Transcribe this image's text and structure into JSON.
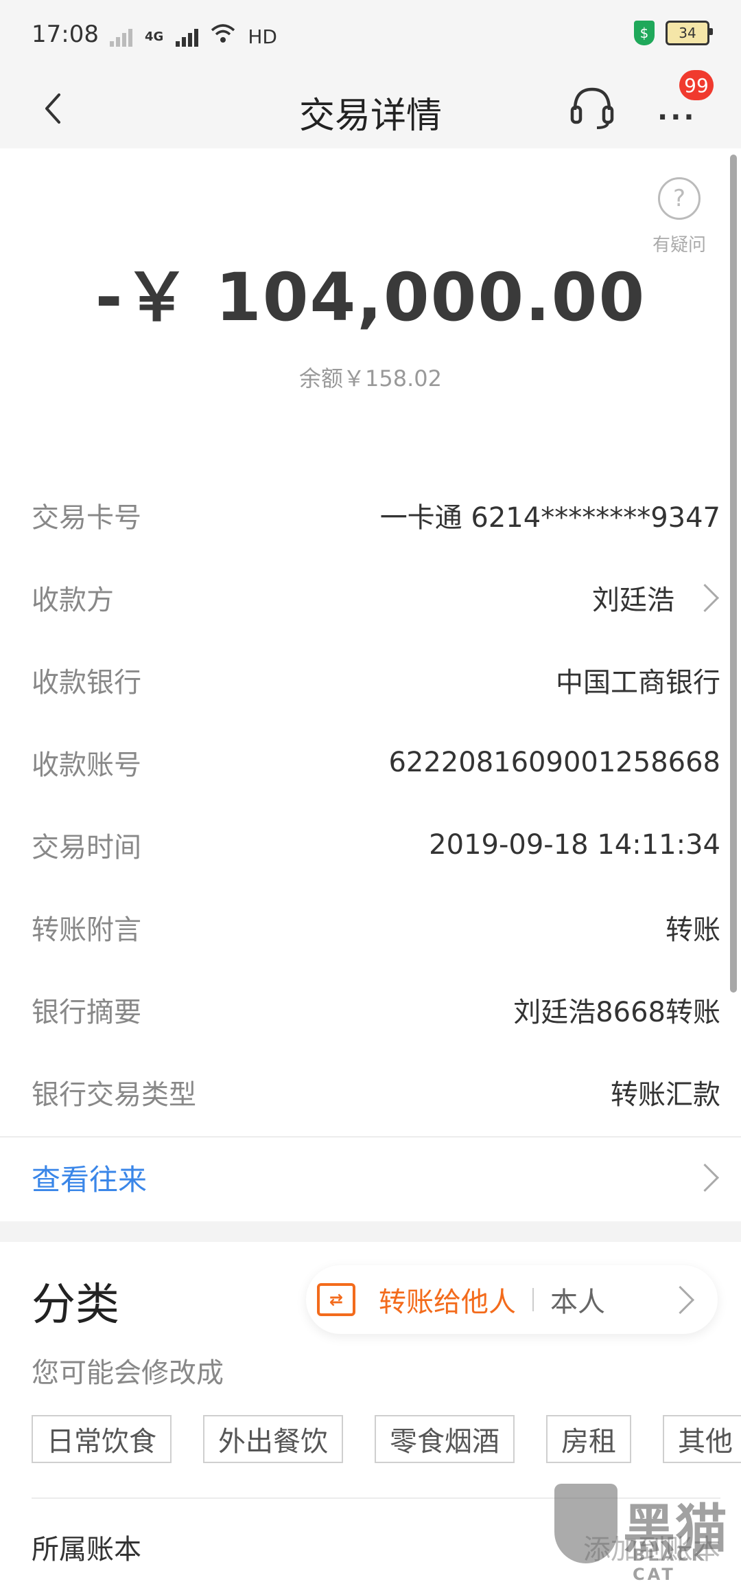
{
  "status": {
    "time": "17:08",
    "network": "4G",
    "hd": "HD",
    "battery": "34"
  },
  "nav": {
    "title": "交易详情",
    "badge": "99"
  },
  "help": {
    "label": "有疑问",
    "glyph": "?"
  },
  "amount": "-￥ 104,000.00",
  "balance": "余额￥158.02",
  "details": [
    {
      "label": "交易卡号",
      "value": "一卡通 6214********9347"
    },
    {
      "label": "收款方",
      "value": "刘廷浩"
    },
    {
      "label": "收款银行",
      "value": "中国工商银行"
    },
    {
      "label": "收款账号",
      "value": "6222081609001258668"
    },
    {
      "label": "交易时间",
      "value": "2019-09-18 14:11:34"
    },
    {
      "label": "转账附言",
      "value": "转账"
    },
    {
      "label": "银行摘要",
      "value": "刘廷浩8668转账"
    },
    {
      "label": "银行交易类型",
      "value": "转账汇款"
    }
  ],
  "link": {
    "label": "查看往来"
  },
  "category": {
    "title": "分类",
    "selected": "转账给他人",
    "other": "本人",
    "suggest_label": "您可能会修改成",
    "tags": [
      "日常饮食",
      "外出餐饮",
      "零食烟酒",
      "房租",
      "其他"
    ]
  },
  "account": {
    "label": "所属账本",
    "value": "添加到账本"
  },
  "watermark": {
    "text": "黑猫",
    "sub": "BLACK CAT"
  },
  "colors": {
    "accent_orange": "#f36b1c",
    "link_blue": "#3a86e8",
    "badge_red": "#f03a2e"
  }
}
